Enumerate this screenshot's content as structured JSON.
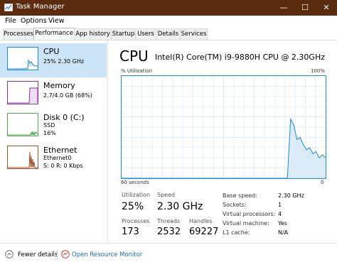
{
  "window": {
    "title": "Task Manager",
    "controls": [
      "—",
      "☐",
      "✕"
    ]
  },
  "menu": {
    "items": [
      "File",
      "Options",
      "View"
    ]
  },
  "tabs": [
    "Processes",
    "Performance",
    "App history",
    "Startup",
    "Users",
    "Details",
    "Services"
  ],
  "sidebar": {
    "items": [
      {
        "name": "CPU",
        "line1": "25% 2.30 GHz",
        "line2": "",
        "line3": ""
      },
      {
        "name": "Memory",
        "line1": "2.7/4.0 GB (68%)",
        "line2": "",
        "line3": ""
      },
      {
        "name": "Disk 0 (C:)",
        "line1": "SSD",
        "line2": "16%",
        "line3": ""
      },
      {
        "name": "Ethernet",
        "line1": "Ethernet0",
        "line2": "S: 0 R: 0 Kbps",
        "line3": ""
      }
    ],
    "colors": {
      "cpu": "#1a8cd8",
      "memory": "#8b2fa6",
      "disk": "#4ca64c",
      "ethernet": "#a0522d"
    }
  },
  "main": {
    "title": "CPU",
    "model": "Intel(R) Core(TM) i9-9880H CPU @ 2.30GHz",
    "ylabel": "% Utilization",
    "ymax": "100%",
    "xlabel": "60 seconds",
    "xmin": "0",
    "graph_samples": [
      0,
      0,
      0,
      0,
      0,
      0,
      0,
      0,
      0,
      0,
      0,
      0,
      0,
      0,
      0,
      0,
      0,
      0,
      0,
      0,
      0,
      0,
      0,
      0,
      0,
      0,
      0,
      0,
      0,
      0,
      0,
      0,
      0,
      0,
      0,
      0,
      0,
      0,
      0,
      0,
      0,
      0,
      0,
      0,
      0,
      0,
      0,
      0,
      0,
      0,
      0,
      0,
      0,
      58,
      52,
      38,
      40,
      33,
      28,
      30,
      24,
      26,
      20,
      23,
      20
    ]
  },
  "stats": {
    "utilization_label": "Utilization",
    "utilization": "25%",
    "speed_label": "Speed",
    "speed": "2.30 GHz",
    "processes_label": "Processes",
    "processes": "173",
    "threads_label": "Threads",
    "threads": "2532",
    "handles_label": "Handles",
    "handles": "69227"
  },
  "info": [
    {
      "label": "Base speed:",
      "value": "2.30 GHz"
    },
    {
      "label": "Sockets:",
      "value": "1"
    },
    {
      "label": "Virtual processors:",
      "value": "4"
    },
    {
      "label": "Virtual machine:",
      "value": "Yes"
    },
    {
      "label": "L1 cache:",
      "value": "N/A"
    }
  ],
  "footer": {
    "fewer_details": "Fewer details",
    "resource_monitor": "Open Resource Monitor"
  }
}
